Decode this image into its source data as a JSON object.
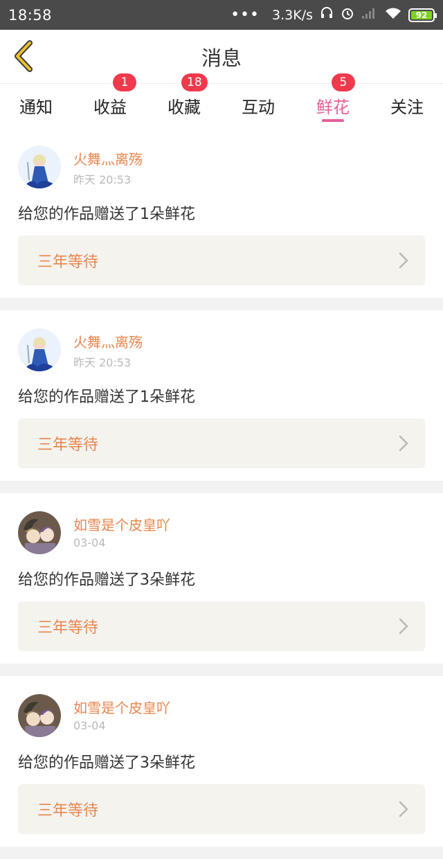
{
  "status_bar": {
    "time": "18:58",
    "dots": "•••",
    "speed": "3.3K/s",
    "battery": "92"
  },
  "nav": {
    "title": "消息"
  },
  "tabs": [
    {
      "label": "通知",
      "badge": ""
    },
    {
      "label": "收益",
      "badge": "1"
    },
    {
      "label": "收藏",
      "badge": "18"
    },
    {
      "label": "互动",
      "badge": ""
    },
    {
      "label": "鲜花",
      "badge": "5",
      "active": true
    },
    {
      "label": "关注",
      "badge": ""
    }
  ],
  "messages": [
    {
      "username": "火舞灬离殇",
      "time": "昨天 20:53",
      "text": "给您的作品赠送了1朵鲜花",
      "work": "三年等待"
    },
    {
      "username": "火舞灬离殇",
      "time": "昨天 20:53",
      "text": "给您的作品赠送了1朵鲜花",
      "work": "三年等待"
    },
    {
      "username": "如雪是个皮皇吖",
      "time": "03-04",
      "text": "给您的作品赠送了3朵鲜花",
      "work": "三年等待"
    },
    {
      "username": "如雪是个皮皇吖",
      "time": "03-04",
      "text": "给您的作品赠送了3朵鲜花",
      "work": "三年等待"
    }
  ],
  "colors": {
    "accent_pink": "#e55f97",
    "badge_red": "#f0394d",
    "username_orange": "#e8854e",
    "back_arrow_yellow": "#f2c12e"
  }
}
